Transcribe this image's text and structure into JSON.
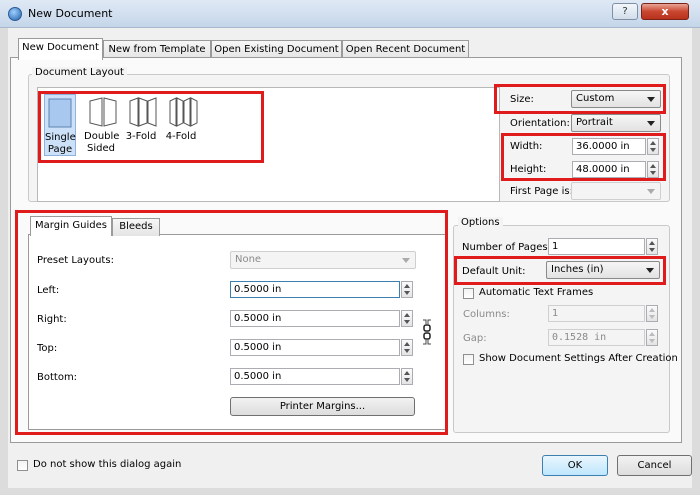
{
  "window": {
    "title": "New Document",
    "help": "?",
    "close": "x"
  },
  "tabs": [
    "New Document",
    "New from Template",
    "Open Existing Document",
    "Open Recent Document"
  ],
  "document_layout": {
    "group_label": "Document Layout",
    "options": [
      {
        "line1": "Single",
        "line2": "Page",
        "selected": true
      },
      {
        "line1": "Double",
        "line2": "Sided",
        "selected": false
      },
      {
        "line1": "3-Fold",
        "line2": "",
        "selected": false
      },
      {
        "line1": "4-Fold",
        "line2": "",
        "selected": false
      }
    ],
    "size_label": "Size:",
    "size_value": "Custom",
    "orientation_label": "Orientation:",
    "orientation_value": "Portrait",
    "width_label": "Width:",
    "width_value": "36.0000 in",
    "height_label": "Height:",
    "height_value": "48.0000 in",
    "first_page_label": "First Page is:",
    "first_page_value": ""
  },
  "margins": {
    "tabs": [
      "Margin Guides",
      "Bleeds"
    ],
    "preset_label": "Preset Layouts:",
    "preset_value": "None",
    "left_label": "Left:",
    "left_value": "0.5000 in",
    "right_label": "Right:",
    "right_value": "0.5000 in",
    "top_label": "Top:",
    "top_value": "0.5000 in",
    "bottom_label": "Bottom:",
    "bottom_value": "0.5000 in",
    "printer_margins_button": "Printer Margins..."
  },
  "options": {
    "group_label": "Options",
    "num_pages_label": "Number of Pages:",
    "num_pages_value": "1",
    "default_unit_label": "Default Unit:",
    "default_unit_value": "Inches (in)",
    "auto_text_frames": "Automatic Text Frames",
    "columns_label": "Columns:",
    "columns_value": "1",
    "gap_label": "Gap:",
    "gap_value": "0.1528 in",
    "show_settings": "Show Document Settings After Creation"
  },
  "footer": {
    "dont_show": "Do not show this dialog again",
    "ok": "OK",
    "cancel": "Cancel"
  },
  "colors": {
    "highlight": "#e01b1b",
    "selection": "#cce0f7"
  }
}
